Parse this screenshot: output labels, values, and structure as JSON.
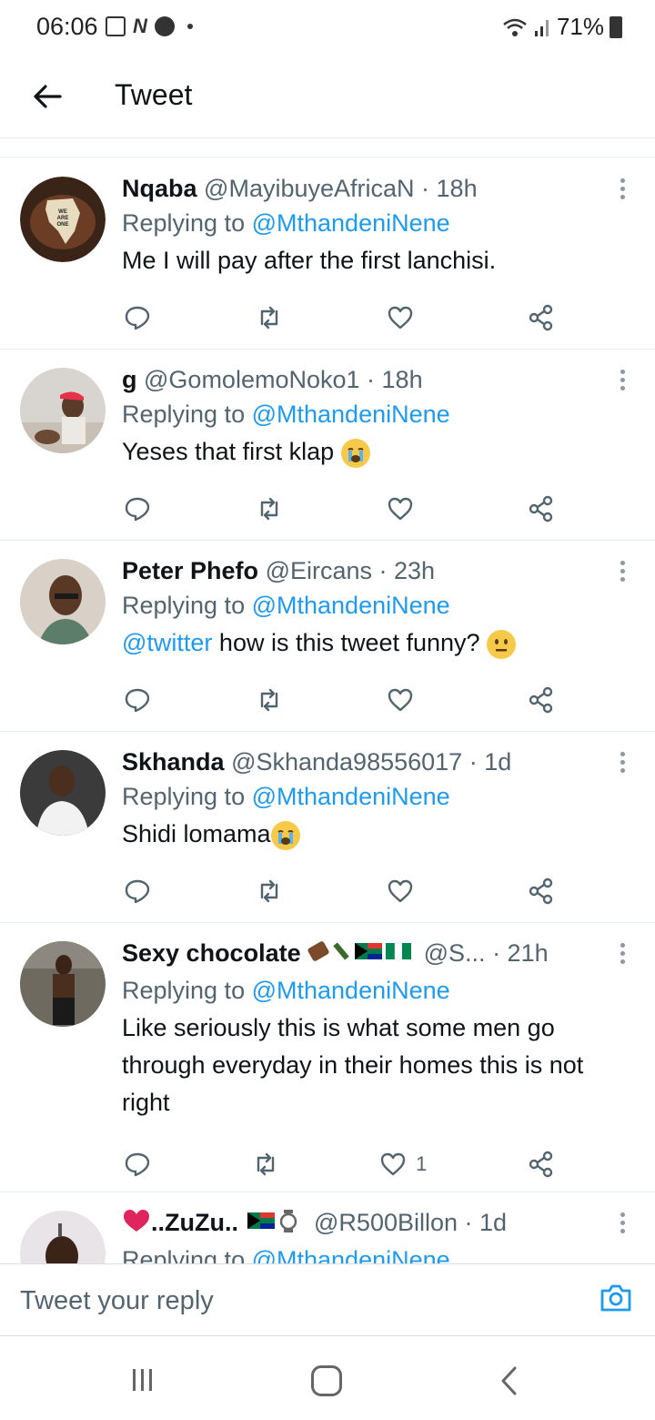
{
  "status_bar": {
    "time": "06:06",
    "battery": "71%"
  },
  "header": {
    "title": "Tweet"
  },
  "colors": {
    "accent": "#1d9bf0",
    "secondary_text": "#536471",
    "primary_text": "#0f1419"
  },
  "tweets": [
    {
      "name": "Nqaba",
      "handle": "@MayibuyeAfricaN",
      "time": "· 18h",
      "replying_prefix": "Replying to",
      "replying_to": "@MthandeniNene",
      "text": "Me I will pay after the first lanchisi.",
      "avatar_text": "WE ARE ONE",
      "likes": ""
    },
    {
      "name": "g",
      "handle": "@GomolemoNoko1",
      "time": "· 18h",
      "replying_prefix": "Replying to",
      "replying_to": "@MthandeniNene",
      "text": "Yeses that first klap",
      "likes": ""
    },
    {
      "name": "Peter Phefo",
      "handle": "@Eircans",
      "time": "· 23h",
      "replying_prefix": "Replying to",
      "replying_to": "@MthandeniNene",
      "text_mention": "@twitter",
      "text": " how is this tweet funny?",
      "likes": ""
    },
    {
      "name": "Skhanda",
      "handle": "@Skhanda98556017",
      "time": "· 1d",
      "replying_prefix": "Replying to",
      "replying_to": "@MthandeniNene",
      "text": "Shidi lomama",
      "likes": ""
    },
    {
      "name": "Sexy chocolate",
      "handle": "@S...",
      "time": "· 21h",
      "replying_prefix": "Replying to",
      "replying_to": "@MthandeniNene",
      "text": "Like seriously this is what some men go through everyday in their homes this is not right",
      "likes": "1"
    },
    {
      "name": "..ZuZu..",
      "handle": "@R500Billon",
      "time": "· 1d",
      "replying_prefix": "Replying to",
      "replying_to": "@MthandeniNene",
      "text": "",
      "likes": ""
    }
  ],
  "reply_bar": {
    "placeholder": "Tweet your reply"
  },
  "icons": {
    "back": "arrow-left-icon",
    "more": "more-vertical-icon",
    "reply": "reply-icon",
    "retweet": "retweet-icon",
    "like": "heart-icon",
    "share": "share-icon",
    "camera": "camera-icon"
  }
}
